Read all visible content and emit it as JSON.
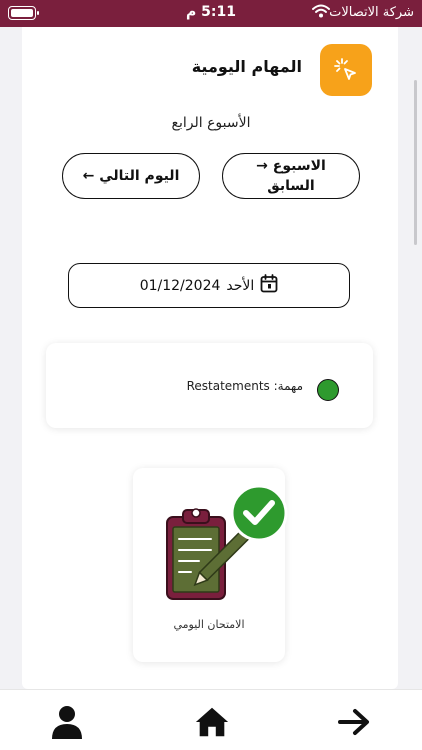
{
  "status_bar": {
    "carrier": "شركة الاتصالات",
    "time": "5:11 م"
  },
  "header": {
    "title": "المهام اليومية"
  },
  "week": {
    "label": "الأسبوع الرابع"
  },
  "nav_buttons": {
    "prev_line1": "الاسبوع",
    "prev_line2": "السابق",
    "prev_arrow": "→",
    "next_label": "اليوم التالي",
    "next_arrow": "←"
  },
  "date": {
    "day": "الأحد",
    "value": "01/12/2024"
  },
  "task": {
    "prefix": "مهمة:",
    "name": "Restatements",
    "status_color": "#2e9a2e"
  },
  "exam_card": {
    "label": "الامتحان اليومي"
  },
  "colors": {
    "brand": "#7a1f3d",
    "accent": "#f7a21a",
    "status_green": "#2e9a2e",
    "clipboard": "#7a1f3d",
    "paper": "#5d6e35"
  },
  "bottom_nav": {
    "items": [
      "profile-icon",
      "home-icon",
      "arrow-right-icon"
    ]
  }
}
